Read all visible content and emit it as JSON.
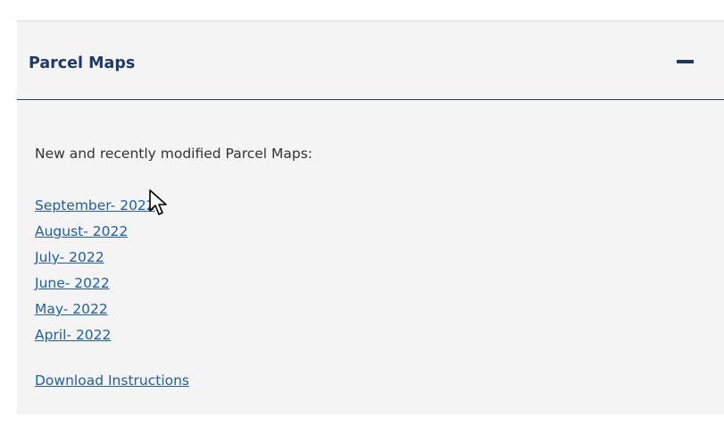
{
  "panel": {
    "title": "Parcel Maps",
    "collapse_icon": "minus-icon"
  },
  "content": {
    "intro": "New and recently modified Parcel Maps:",
    "months": [
      {
        "label": "September- 2022"
      },
      {
        "label": "August- 2022"
      },
      {
        "label": "July- 2022"
      },
      {
        "label": "June- 2022"
      },
      {
        "label": "May- 2022"
      },
      {
        "label": "April- 2022"
      }
    ],
    "download_label": "Download Instructions"
  },
  "colors": {
    "panel_background": "#f4f4f4",
    "title": "#1d3a66",
    "link": "#1f5da8",
    "text": "#333333"
  },
  "cursor_icon": "mouse-pointer-icon"
}
